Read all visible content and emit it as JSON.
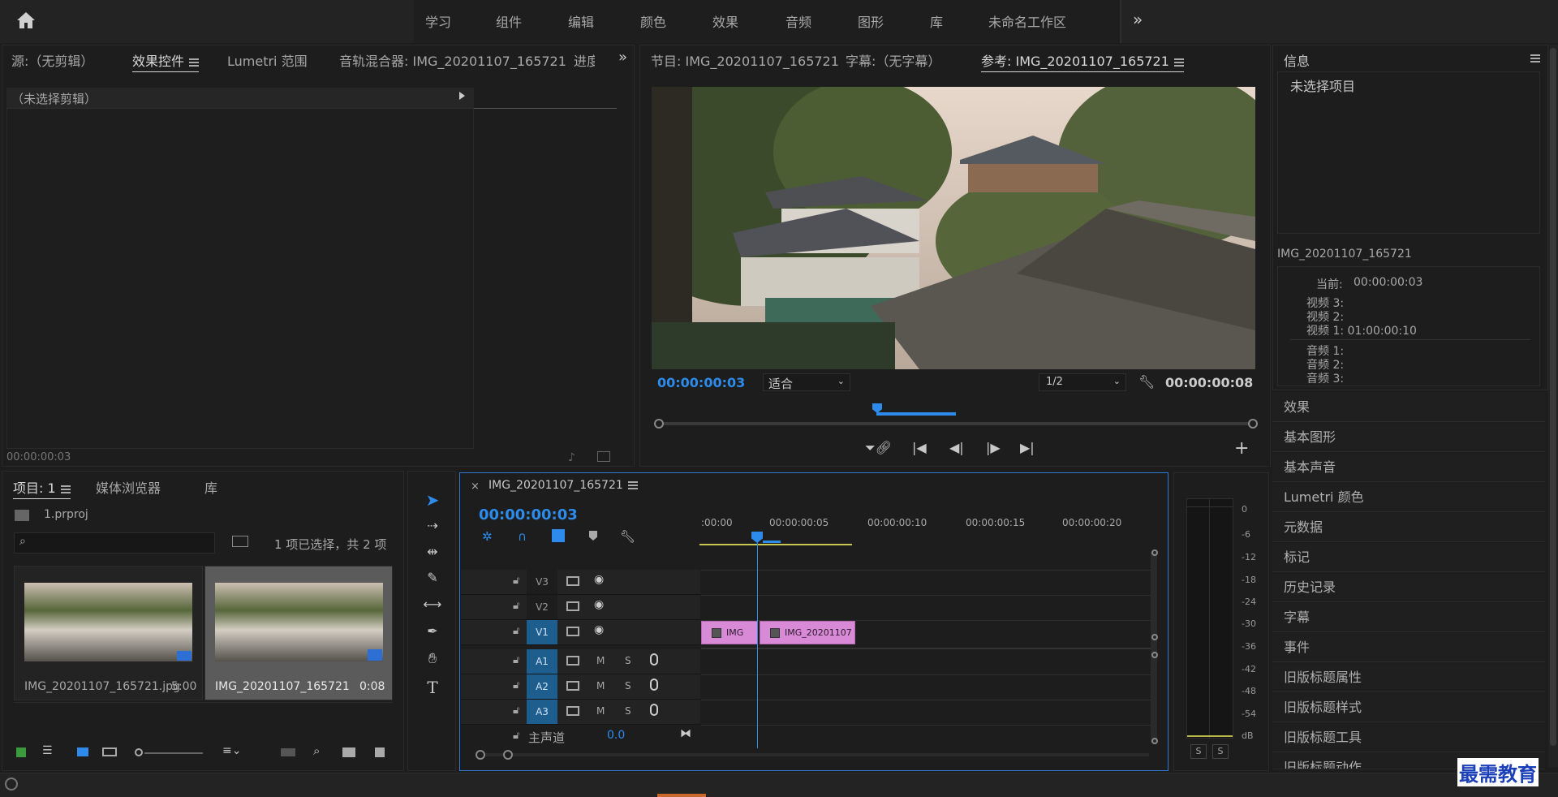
{
  "topbar": {
    "workspaces": [
      "学习",
      "组件",
      "编辑",
      "颜色",
      "效果",
      "音频",
      "图形",
      "库",
      "未命名工作区"
    ],
    "more": "»"
  },
  "source_panel": {
    "tabs": [
      "源:（无剪辑）",
      "效果控件",
      "Lumetri 范围",
      "音轨混合器: IMG_20201107_165721",
      "进度"
    ],
    "no_clip": "（未选择剪辑）",
    "timecode": "00:00:00:03"
  },
  "program_panel": {
    "tabs": [
      "节目: IMG_20201107_165721",
      "字幕:（无字幕）",
      "参考: IMG_20201107_165721"
    ],
    "timecode": "00:00:00:03",
    "fit": "适合",
    "resolution": "1/2",
    "duration": "00:00:00:08"
  },
  "info_panel": {
    "title": "信息",
    "no_selection": "未选择项目",
    "sequence": "IMG_20201107_165721",
    "current_label": "当前:",
    "current_value": "00:00:00:03",
    "video_lines": [
      {
        "label": "视频 3:",
        "value": ""
      },
      {
        "label": "视频 2:",
        "value": ""
      },
      {
        "label": "视频 1:",
        "value": "01:00:00:10"
      }
    ],
    "audio_lines": [
      "音频 1:",
      "音频 2:",
      "音频 3:"
    ]
  },
  "right_panels": [
    "效果",
    "基本图形",
    "基本声音",
    "Lumetri 颜色",
    "元数据",
    "标记",
    "历史记录",
    "字幕",
    "事件",
    "旧版标题属性",
    "旧版标题样式",
    "旧版标题工具",
    "旧版标题动作"
  ],
  "project_panel": {
    "tabs": [
      "项目: 1",
      "媒体浏览器",
      "库"
    ],
    "file": "1.prproj",
    "selection_info": "1 项已选择，共 2 项",
    "items": [
      {
        "name": "IMG_20201107_165721.jpg",
        "duration": "5:00"
      },
      {
        "name": "IMG_20201107_165721",
        "duration": "0:08"
      }
    ]
  },
  "timeline": {
    "close": "×",
    "title": "IMG_20201107_165721",
    "timecode": "00:00:00:03",
    "ruler": [
      ":00:00",
      "00:00:00:05",
      "00:00:00:10",
      "00:00:00:15",
      "00:00:00:20"
    ],
    "video_tracks": [
      "V3",
      "V2",
      "V1"
    ],
    "audio_tracks": [
      "A1",
      "A2",
      "A3"
    ],
    "mute": "M",
    "solo": "S",
    "master_label": "主声道",
    "master_value": "0.0",
    "clips": [
      "IMG",
      "IMG_20201107"
    ]
  },
  "meter": {
    "scale": [
      "0",
      "-6",
      "-12",
      "-18",
      "-24",
      "-30",
      "-36",
      "-42",
      "-48",
      "-54",
      "dB"
    ],
    "solo_buttons": [
      "S",
      "S"
    ]
  },
  "watermark": "最需教育"
}
